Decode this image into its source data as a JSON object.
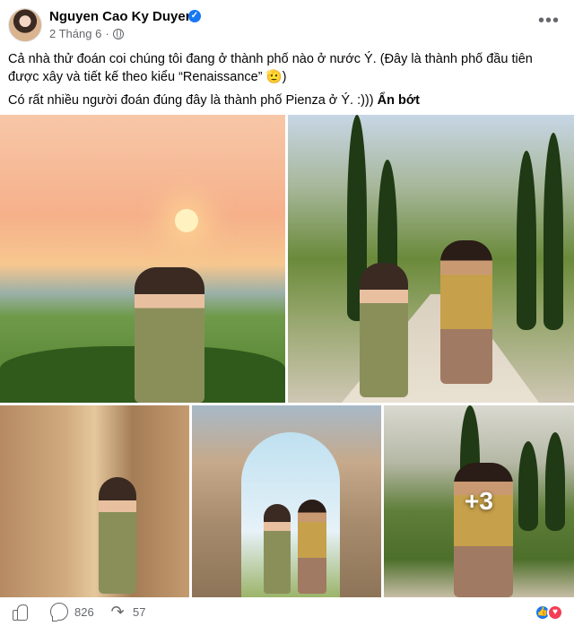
{
  "post": {
    "author": "Nguyen Cao Ky Duyen",
    "verified_badge": "verified-badge",
    "date": "2 Tháng 6",
    "separator": "·",
    "privacy_icon": "globe-icon",
    "more_options_icon": "more-horizontal-icon",
    "more_options_glyph": "•••",
    "paragraphs": [
      "Cả nhà thử đoán coi chúng tôi đang ở thành phố nào ở nước Ý. (Đây là thành phố đầu tiên được xây và tiết kế theo kiểu “Renaissance” 🫡)",
      "Có rất nhiều người đoán đúng đây là thành phố Pienza ở Ý. :)))"
    ],
    "see_less": "Ẩn bớt",
    "photos": [
      {
        "label": "sunset-landscape-woman-photo"
      },
      {
        "label": "cypress-road-couple-photo"
      },
      {
        "label": "alley-woman-photo"
      },
      {
        "label": "arch-couple-photo"
      },
      {
        "label": "cypress-road-man-photo"
      }
    ],
    "more_photos": "+3"
  },
  "actions": {
    "like_icon": "thumbs-up-icon",
    "comment_icon": "comment-icon",
    "comment_count": "826",
    "share_icon": "share-icon",
    "share_glyph": "↷",
    "share_count": "57",
    "reactions": [
      "like-reaction-icon",
      "love-reaction-icon"
    ],
    "like_glyph": "👍",
    "love_glyph": "♥"
  },
  "colors": {
    "text": "#050505",
    "secondary_text": "#65676b",
    "brand_blue": "#1877f2",
    "love_red": "#f33e58"
  }
}
